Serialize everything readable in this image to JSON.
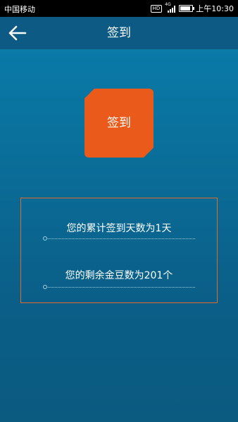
{
  "status_bar": {
    "carrier": "中国移动",
    "hd_badge": "HD",
    "network": "4G",
    "time": "上午10:30"
  },
  "header": {
    "title": "签到",
    "back_icon": "arrow-left-icon"
  },
  "checkin": {
    "button_label": "签到"
  },
  "info": {
    "days_text": "您的累计签到天数为1天",
    "beans_text": "您的剩余金豆数为201个"
  },
  "colors": {
    "header_bg": "#0d5a84",
    "accent": "#ea5a1b",
    "panel_border": "#e06a2c"
  }
}
